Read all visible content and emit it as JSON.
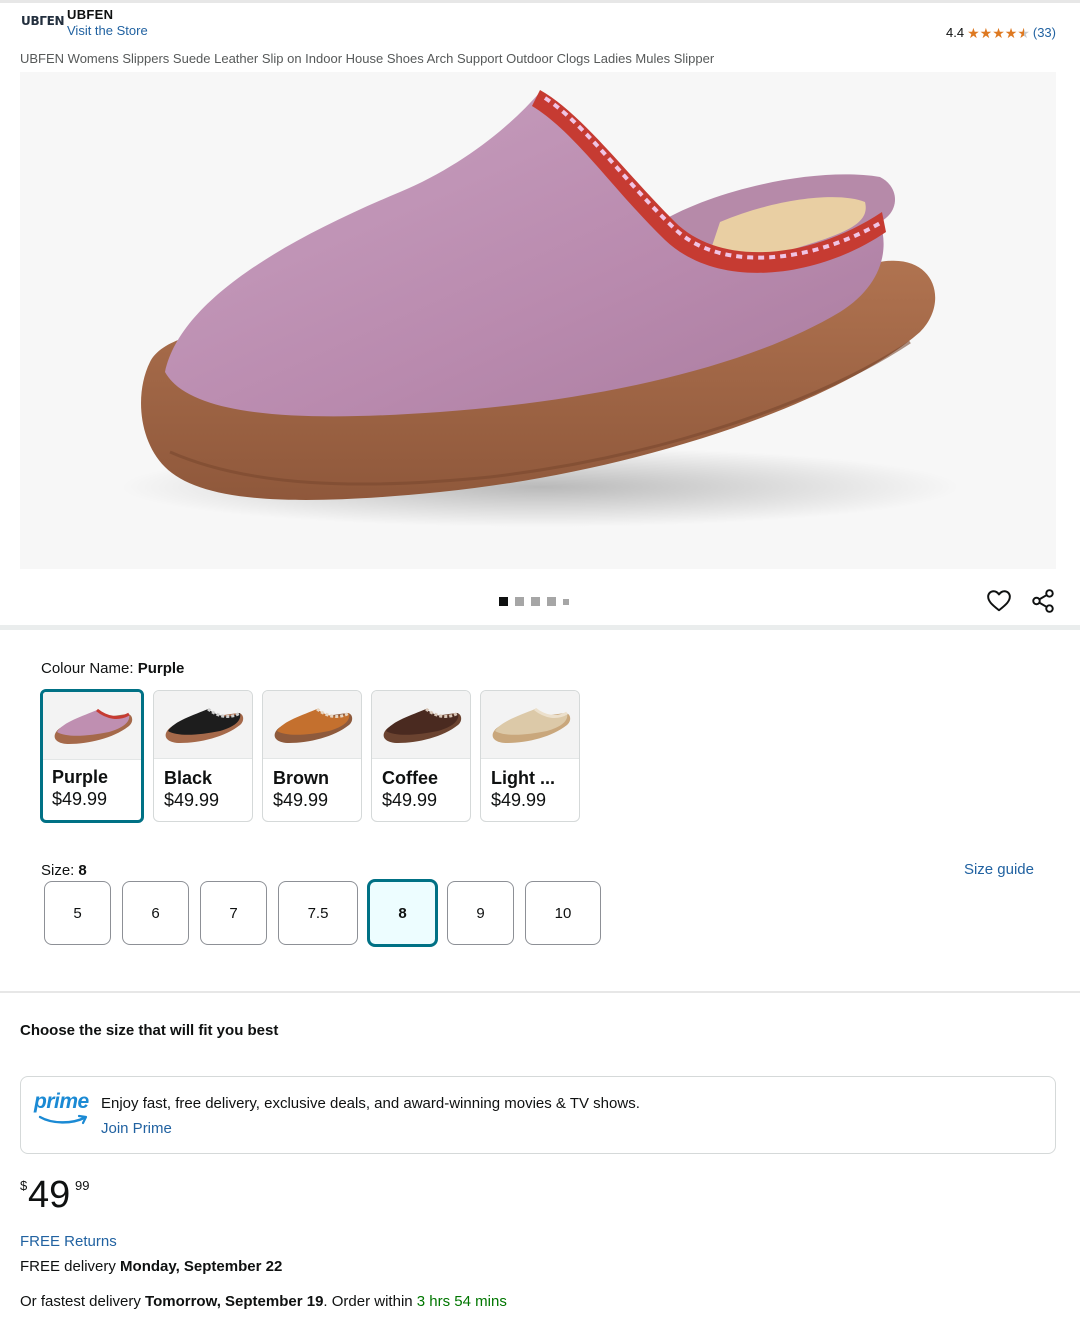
{
  "header": {
    "brand_logo_text": "UBΓEN",
    "brand_name": "UBFEN",
    "store_link": "Visit the Store",
    "rating_value": "4.4",
    "rating_count": "(33)",
    "stars_filled": 4.5
  },
  "product": {
    "title": "UBFEN Womens Slippers Suede Leather Slip on Indoor House Shoes Arch Support Outdoor Clogs Ladies Mules Slipper"
  },
  "gallery": {
    "image_count": 5,
    "active_index": 0
  },
  "colour": {
    "label": "Colour Name:",
    "selected": "Purple",
    "options": [
      {
        "name": "Purple",
        "price": "$49.99",
        "color": "#bf8fb1"
      },
      {
        "name": "Black",
        "price": "$49.99",
        "color": "#1d1d1d"
      },
      {
        "name": "Brown",
        "price": "$49.99",
        "color": "#c4702e"
      },
      {
        "name": "Coffee",
        "price": "$49.99",
        "color": "#4a2a20"
      },
      {
        "name": "Light ...",
        "price": "$49.99",
        "color": "#dcc9a8"
      }
    ]
  },
  "size": {
    "label": "Size:",
    "selected": "8",
    "guide_link": "Size guide",
    "options": [
      "5",
      "6",
      "7",
      "7.5",
      "8",
      "9",
      "10"
    ]
  },
  "fit": {
    "heading": "Choose the size that will fit you best"
  },
  "prime": {
    "logo_text": "prime",
    "message": "Enjoy fast, free delivery, exclusive deals, and award-winning movies & TV shows.",
    "join_link": "Join Prime"
  },
  "price": {
    "symbol": "$",
    "whole": "49",
    "fraction": "99"
  },
  "delivery": {
    "free_returns": "FREE Returns",
    "free_delivery_prefix": "FREE delivery",
    "free_delivery_date": "Monday, September 22",
    "fastest_prefix": "Or fastest delivery",
    "fastest_date": "Tomorrow, September 19",
    "order_within_prefix": ". Order within",
    "order_within_time": "3 hrs 54 mins"
  },
  "colors": {
    "link": "#2162a1",
    "selected_border": "#007185",
    "star": "#de7921",
    "prime_blue": "#1b8ad4",
    "countdown_green": "#007600"
  }
}
